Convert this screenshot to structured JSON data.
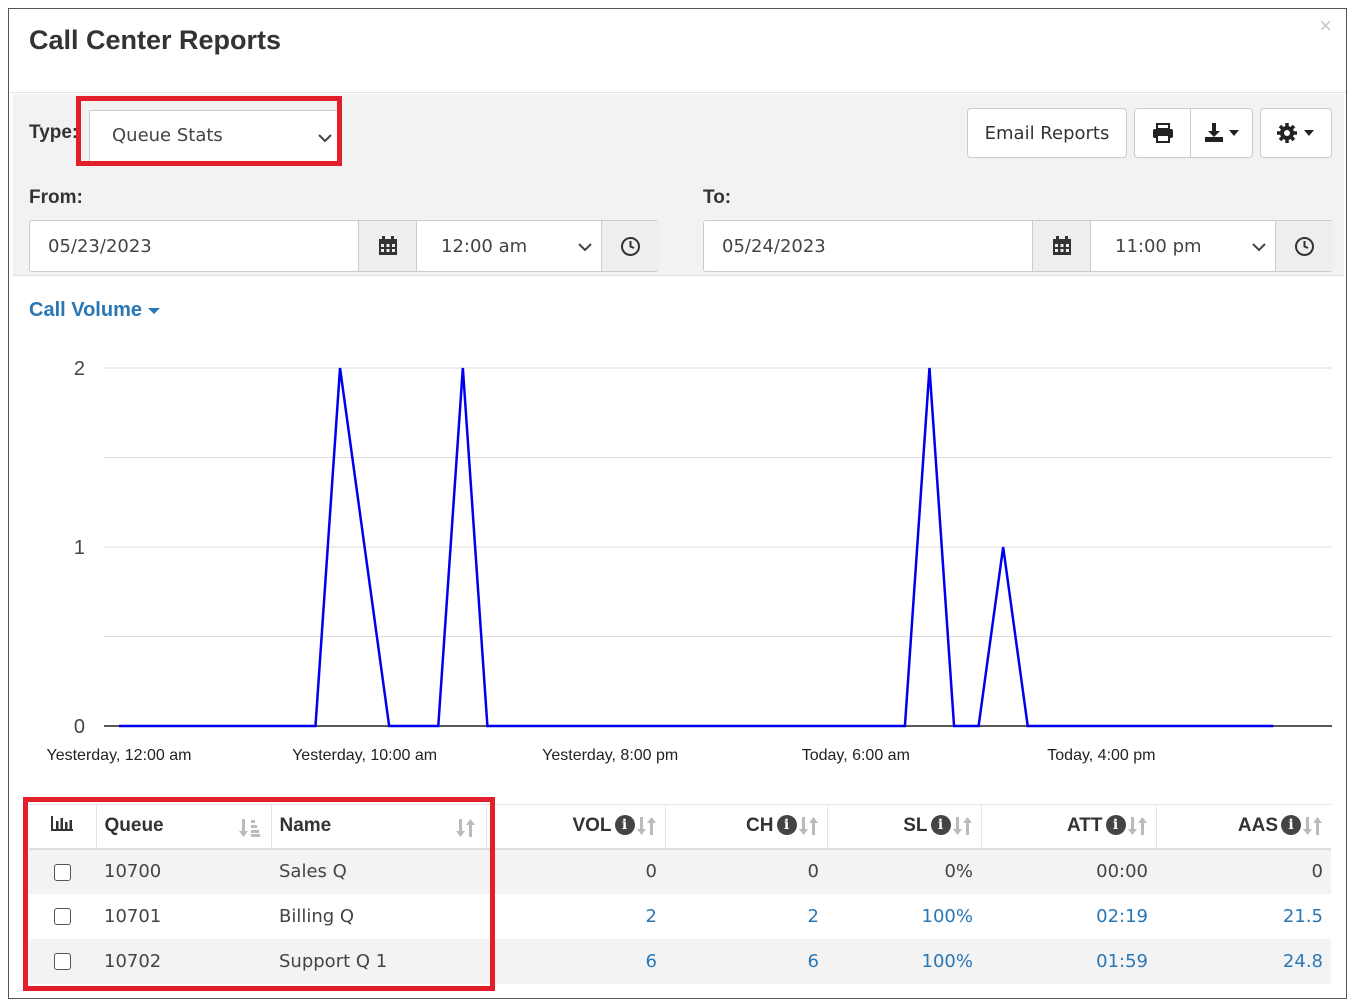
{
  "header": {
    "title": "Call Center Reports",
    "close_label": "×"
  },
  "filters": {
    "type_label": "Type:",
    "type_value": "Queue Stats",
    "from_label": "From:",
    "to_label": "To:",
    "from_date": "05/23/2023",
    "from_time": "12:00 am",
    "to_date": "05/24/2023",
    "to_time": "11:00 pm",
    "email_reports_label": "Email Reports"
  },
  "icons": {
    "print": "print-icon",
    "download": "download-icon",
    "settings": "gear-icon",
    "calendar": "calendar-icon",
    "clock": "clock-icon",
    "chart_toggle": "bar-chart-icon",
    "info": "info-icon",
    "sort": "sort-icon"
  },
  "chart_section": {
    "title": "Call Volume"
  },
  "chart_data": {
    "type": "line",
    "title": "",
    "xlabel": "",
    "ylabel": "",
    "x_tick_labels": [
      "Yesterday, 12:00 am",
      "Yesterday, 10:00 am",
      "Yesterday, 8:00 pm",
      "Today, 6:00 am",
      "Today, 4:00 pm"
    ],
    "y_tick_labels": [
      "0",
      "1",
      "2"
    ],
    "ylim": [
      0,
      2
    ],
    "x_unit": "hours from Yesterday 12:00 am",
    "series": [
      {
        "color": "#0000ee",
        "points": [
          [
            0,
            0
          ],
          [
            8,
            0
          ],
          [
            9,
            2
          ],
          [
            11,
            0
          ],
          [
            13,
            0
          ],
          [
            14,
            2
          ],
          [
            15,
            0
          ],
          [
            32,
            0
          ],
          [
            33,
            2
          ],
          [
            34,
            0
          ],
          [
            35,
            0
          ],
          [
            36,
            1
          ],
          [
            37,
            0
          ],
          [
            47,
            0
          ]
        ]
      }
    ],
    "grid": true
  },
  "table": {
    "columns": [
      {
        "key": "chart",
        "label": ""
      },
      {
        "key": "queue",
        "label": "Queue"
      },
      {
        "key": "name",
        "label": "Name"
      },
      {
        "key": "vol",
        "label": "VOL"
      },
      {
        "key": "ch",
        "label": "CH"
      },
      {
        "key": "sl",
        "label": "SL"
      },
      {
        "key": "att",
        "label": "ATT"
      },
      {
        "key": "aas",
        "label": "AAS"
      }
    ],
    "rows": [
      {
        "queue": "10700",
        "name": "Sales Q",
        "vol": "0",
        "ch": "0",
        "sl": "0%",
        "att": "00:00",
        "aas": "0"
      },
      {
        "queue": "10701",
        "name": "Billing Q",
        "vol": "2",
        "ch": "2",
        "sl": "100%",
        "att": "02:19",
        "aas": "21.5"
      },
      {
        "queue": "10702",
        "name": "Support Q 1",
        "vol": "6",
        "ch": "6",
        "sl": "100%",
        "att": "01:59",
        "aas": "24.8"
      }
    ]
  },
  "colors": {
    "accent": "#2a77b5",
    "line": "#0000ee",
    "highlight": "#e31e2b"
  }
}
